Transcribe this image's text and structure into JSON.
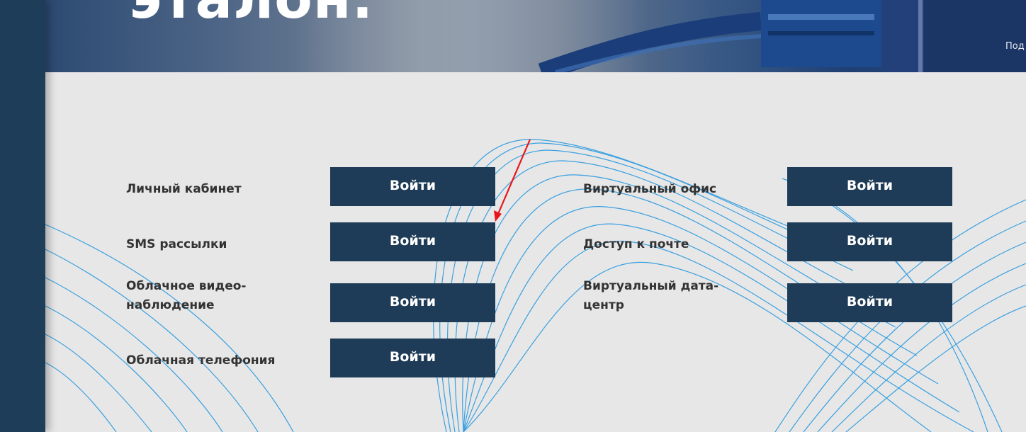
{
  "hero": {
    "title": "эталон.",
    "caption": "Под"
  },
  "services": {
    "left": [
      {
        "label": "Личный кабинет",
        "button": "Войти"
      },
      {
        "label": "SMS рассылки",
        "button": "Войти"
      },
      {
        "label": "Облачное видео-\nнаблюдение",
        "button": "Войти"
      },
      {
        "label": "Облачная телефония",
        "button": "Войти"
      }
    ],
    "right": [
      {
        "label": "Виртуальный офис",
        "button": "Войти"
      },
      {
        "label": "Доступ к почте",
        "button": "Войти"
      },
      {
        "label": "Виртуальный дата-\nцентр",
        "button": "Войти"
      }
    ]
  },
  "colors": {
    "rail": "#1d3d58",
    "button": "#1e3c57",
    "background": "#e7e7e7",
    "lines": "#3aa0e0",
    "annotation_arrow": "#e8161b"
  }
}
